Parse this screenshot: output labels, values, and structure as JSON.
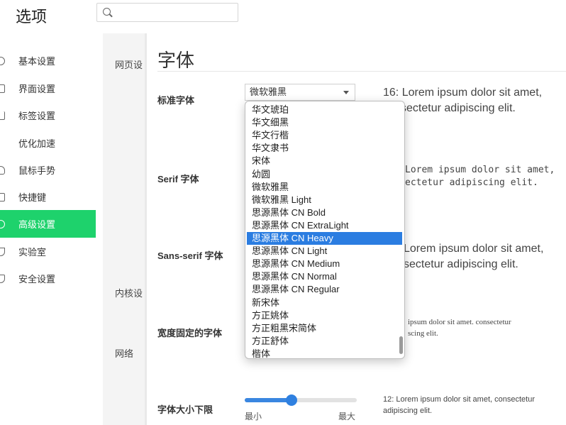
{
  "app": {
    "title": "选项"
  },
  "search": {
    "value": "",
    "placeholder": ""
  },
  "sidebar": {
    "items": [
      {
        "label": "基本设置"
      },
      {
        "label": "界面设置"
      },
      {
        "label": "标签设置"
      },
      {
        "label": "优化加速"
      },
      {
        "label": "鼠标手势"
      },
      {
        "label": "快捷键"
      },
      {
        "label": "高级设置",
        "active": true
      },
      {
        "label": "实验室"
      },
      {
        "label": "安全设置"
      }
    ],
    "accent_color": "#1ed26c"
  },
  "subnav": {
    "items": [
      {
        "label": "网页设"
      },
      {
        "label": "内核设"
      },
      {
        "label": "网络"
      }
    ]
  },
  "main": {
    "section_title": "字体",
    "rows": {
      "standard": {
        "label": "标准字体",
        "selected": "微软雅黑"
      },
      "serif": {
        "label": "Serif 字体"
      },
      "sans_serif": {
        "label": "Sans-serif 字体"
      },
      "fixed_width": {
        "label": "宽度固定的字体"
      },
      "font_size_min": {
        "label": "字体大小下限",
        "slider_min": "最小",
        "slider_max": "最大",
        "slider_value_fraction": 0.41
      }
    },
    "previews": {
      "standard_line1": "16: Lorem ipsum dolor sit amet,",
      "standard_line2": "sectetur adipiscing elit.",
      "serif_line1": "Lorem ipsum dolor sit amet,",
      "serif_line2": "ectetur adipiscing elit.",
      "sans_line1": "Lorem ipsum dolor sit amet,",
      "sans_line2": "sectetur adipiscing elit.",
      "fixed_line1": "ipsum dolor sit amet. consectetur",
      "fixed_line2": "scing elit.",
      "min_line1": "12: Lorem ipsum dolor sit amet, consectetur",
      "min_line2": "adipiscing elit."
    }
  },
  "dropdown": {
    "options": [
      "华文琥珀",
      "华文细黑",
      "华文行楷",
      "华文隶书",
      "宋体",
      "幼圆",
      "微软雅黑",
      "微软雅黑 Light",
      "思源黑体 CN Bold",
      "思源黑体 CN ExtraLight",
      "思源黑体 CN Heavy",
      "思源黑体 CN Light",
      "思源黑体 CN Medium",
      "思源黑体 CN Normal",
      "思源黑体 CN Regular",
      "新宋体",
      "方正姚体",
      "方正粗黑宋简体",
      "方正舒体",
      "楷体"
    ],
    "highlighted_index": 10,
    "highlight_color": "#2b7de1"
  }
}
